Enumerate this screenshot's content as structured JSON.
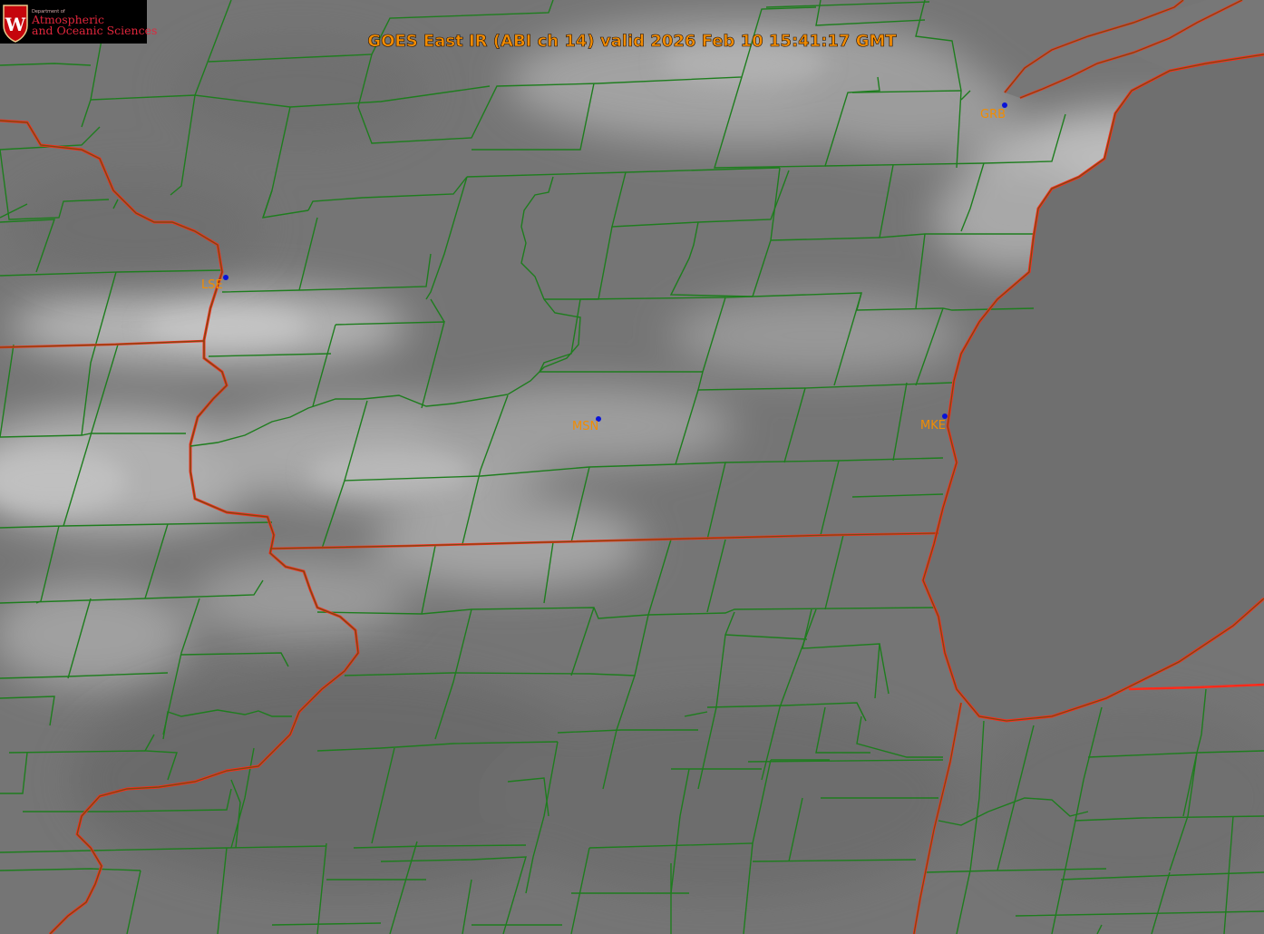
{
  "title": "GOES East IR (ABI ch 14) valid 2026 Feb 10 15:41:17 GMT",
  "logo": {
    "department": "Department of",
    "name_line1": "Atmospheric",
    "name_line2": "and Oceanic Sciences",
    "emblem_letter": "W"
  },
  "stations": [
    {
      "id": "LSE",
      "label": "LSE"
    },
    {
      "id": "MSN",
      "label": "MSN"
    },
    {
      "id": "MKE",
      "label": "MKE"
    },
    {
      "id": "GRB",
      "label": "GRB"
    }
  ],
  "colors": {
    "county_lines": "#1e7d1e",
    "state_boundary": "#ff2a1a",
    "coastline": "#7a4a10",
    "station_marker": "#0a14d8",
    "label_text": "#f28c00",
    "lake_michigan": "#6f6f6f",
    "background_cloud": "#777777"
  }
}
